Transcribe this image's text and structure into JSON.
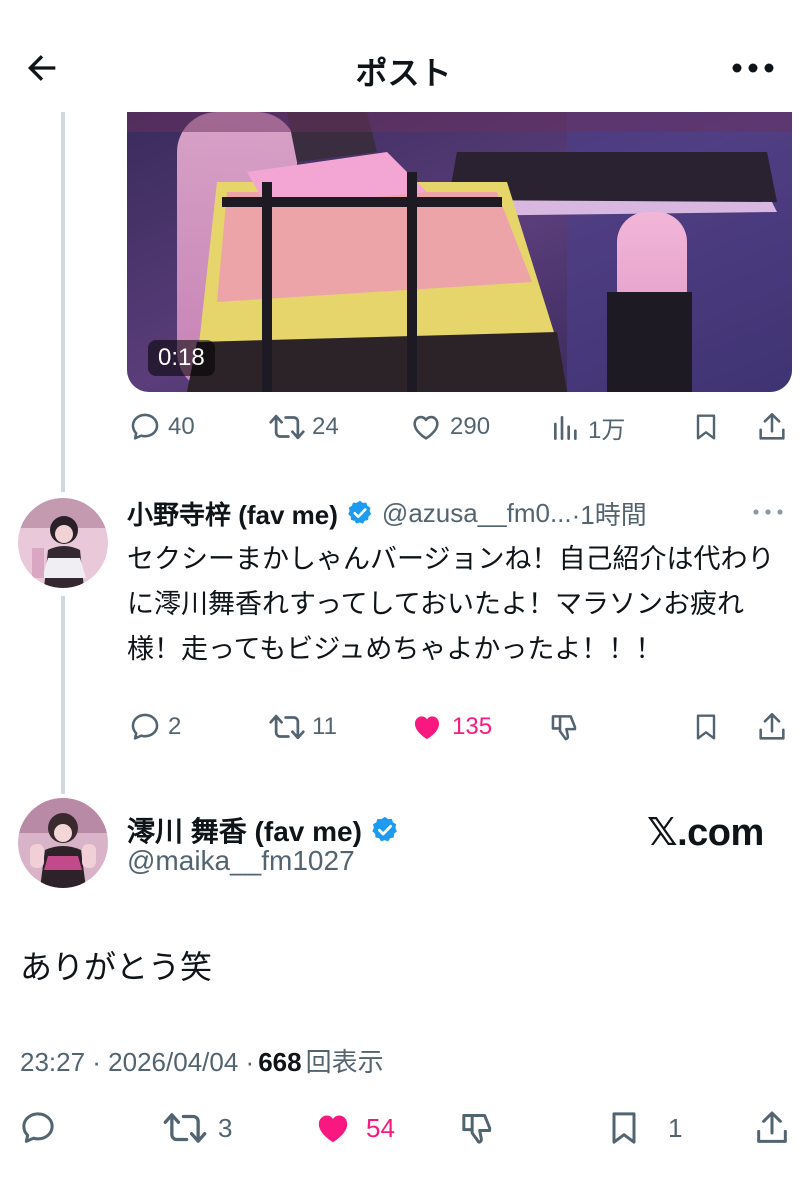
{
  "header": {
    "title": "ポスト",
    "back_icon": "arrow-left-icon",
    "more_icon": "more-horizontal-icon"
  },
  "video": {
    "duration": "0:18"
  },
  "parent_actions": {
    "replies": "40",
    "reposts": "24",
    "likes": "290",
    "views": "1万"
  },
  "reply": {
    "name": "小野寺梓 (fav me)",
    "handle": "@azusa__fm0...",
    "time": "·1時間",
    "text": "セクシーまかしゃんバージョンね！自己紹介は代わりに澪川舞香れすってしておいたよ！マラソンお疲れ様！走ってもビジュめちゃよかったよ！！！",
    "actions": {
      "replies": "2",
      "reposts": "11",
      "likes": "135",
      "liked": true
    }
  },
  "main": {
    "name": "澪川 舞香 (fav me)",
    "handle": "@maika__fm1027",
    "watermark": "𝕏.com",
    "text": "ありがとう笑",
    "time": "23:27 · 2026/04/04 ·",
    "views_count": "668",
    "views_label": "回表示",
    "actions": {
      "reposts": "3",
      "likes": "54",
      "bookmarks": "1",
      "liked": true
    }
  },
  "colors": {
    "accent": "#1d9bf0",
    "like": "#f91880",
    "muted": "#536471",
    "text": "#0f1419",
    "line": "#cfd9de"
  }
}
